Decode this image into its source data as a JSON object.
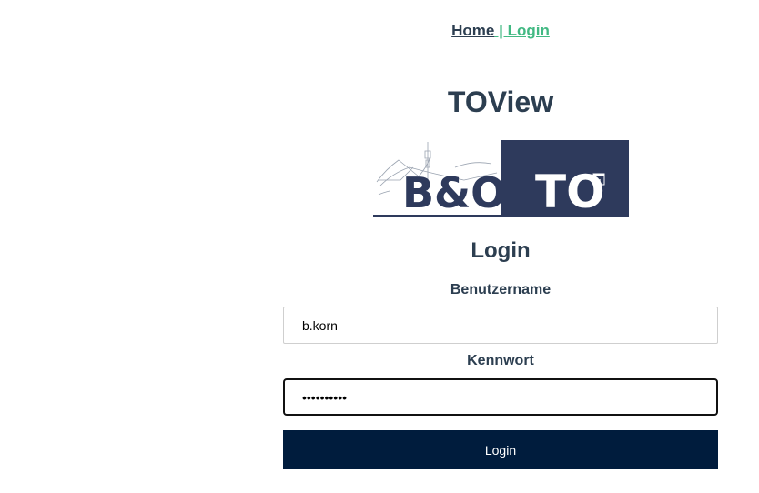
{
  "nav": {
    "home_label": "Home",
    "separator": " | ",
    "login_label": "Login"
  },
  "app": {
    "title": "TOView"
  },
  "logo": {
    "left_text": "B&O",
    "right_text": "TO",
    "calendar_number": "31",
    "colors": {
      "dark": "#2e3a5c",
      "white": "#ffffff",
      "sketch": "#9aa3b0"
    }
  },
  "login": {
    "heading": "Login",
    "username_label": "Benutzername",
    "username_value": "b.korn",
    "password_label": "Kennwort",
    "password_value": "••••••••••",
    "submit_label": "Login"
  },
  "colors": {
    "text": "#2c3e50",
    "link_active": "#42b983",
    "button_bg": "#001c3d"
  }
}
